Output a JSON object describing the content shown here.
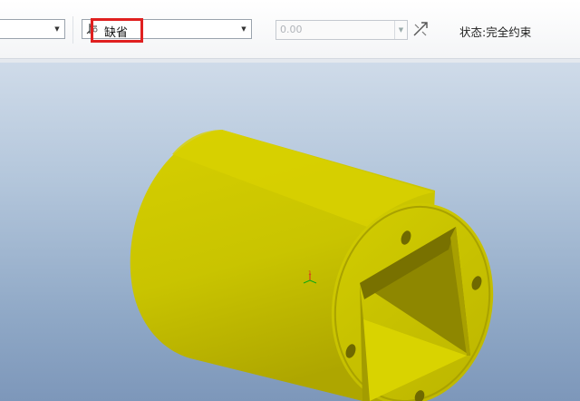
{
  "toolbar": {
    "reference_combo_value": "",
    "default_label": "缺省",
    "offset_value": "0.00",
    "status_label": "状态:",
    "status_value": "完全约束"
  },
  "viewport": {
    "model_color": "#c9c400",
    "background_top": "#cfdbe9",
    "background_bottom": "#7d97ba"
  },
  "icons": [
    "pin-icon",
    "flip-icon",
    "triad-icon"
  ]
}
